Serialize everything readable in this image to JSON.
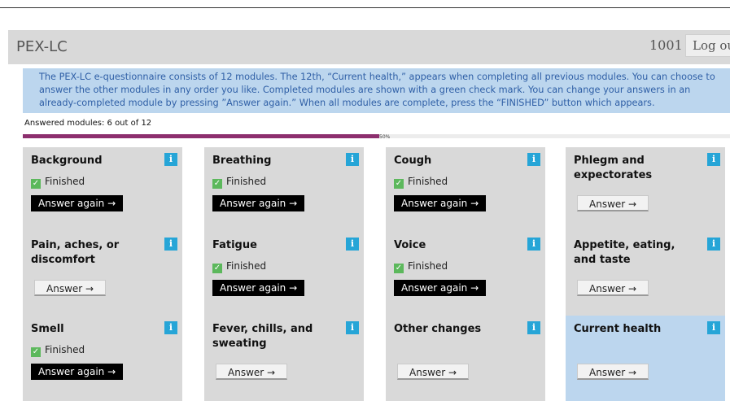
{
  "header": {
    "app_title": "PEX-LC",
    "user_id": "1001",
    "logout_label": "Log out"
  },
  "banner": {
    "text": "The PEX-LC e-questionnaire consists of 12 modules. The 12th, “Current health,” appears when completing all previous modules. You can choose to answer the other modules in any order you like. Completed modules are shown with a green check mark. You can change your answers in an already-completed module by pressing ”Answer again.” When all modules are complete, press the “FINISHED” button which appears."
  },
  "progress": {
    "label": "Answered modules: 6 out of 12",
    "percent_label": "50%",
    "value": 0.5
  },
  "info_icon_glyph": "i",
  "modules": [
    {
      "title": "Background",
      "status": "Finished",
      "button": "Answer again →"
    },
    {
      "title": "Breathing",
      "status": "Finished",
      "button": "Answer again →"
    },
    {
      "title": "Cough",
      "status": "Finished",
      "button": "Answer again →"
    },
    {
      "title": "Phlegm and expectorates",
      "status": "",
      "button": "Answer →"
    },
    {
      "title": "Pain, aches, or discomfort",
      "status": "",
      "button": "Answer →"
    },
    {
      "title": "Fatigue",
      "status": "Finished",
      "button": "Answer again →"
    },
    {
      "title": "Voice",
      "status": "Finished",
      "button": "Answer again →"
    },
    {
      "title": "Appetite, eating, and taste",
      "status": "",
      "button": "Answer →"
    },
    {
      "title": "Smell",
      "status": "Finished",
      "button": "Answer again →"
    },
    {
      "title": "Fever, chills, and sweating",
      "status": "",
      "button": "Answer →"
    },
    {
      "title": "Other changes",
      "status": "",
      "button": "Answer →"
    },
    {
      "title": "Current health",
      "status": "",
      "button": "Answer →"
    }
  ],
  "colors": {
    "progress_fill": "#8d2f6e",
    "info_icon": "#26a5d7",
    "check": "#5cb85c",
    "banner_bg": "#bcd6ee",
    "card_bg": "#d9d9d9"
  }
}
